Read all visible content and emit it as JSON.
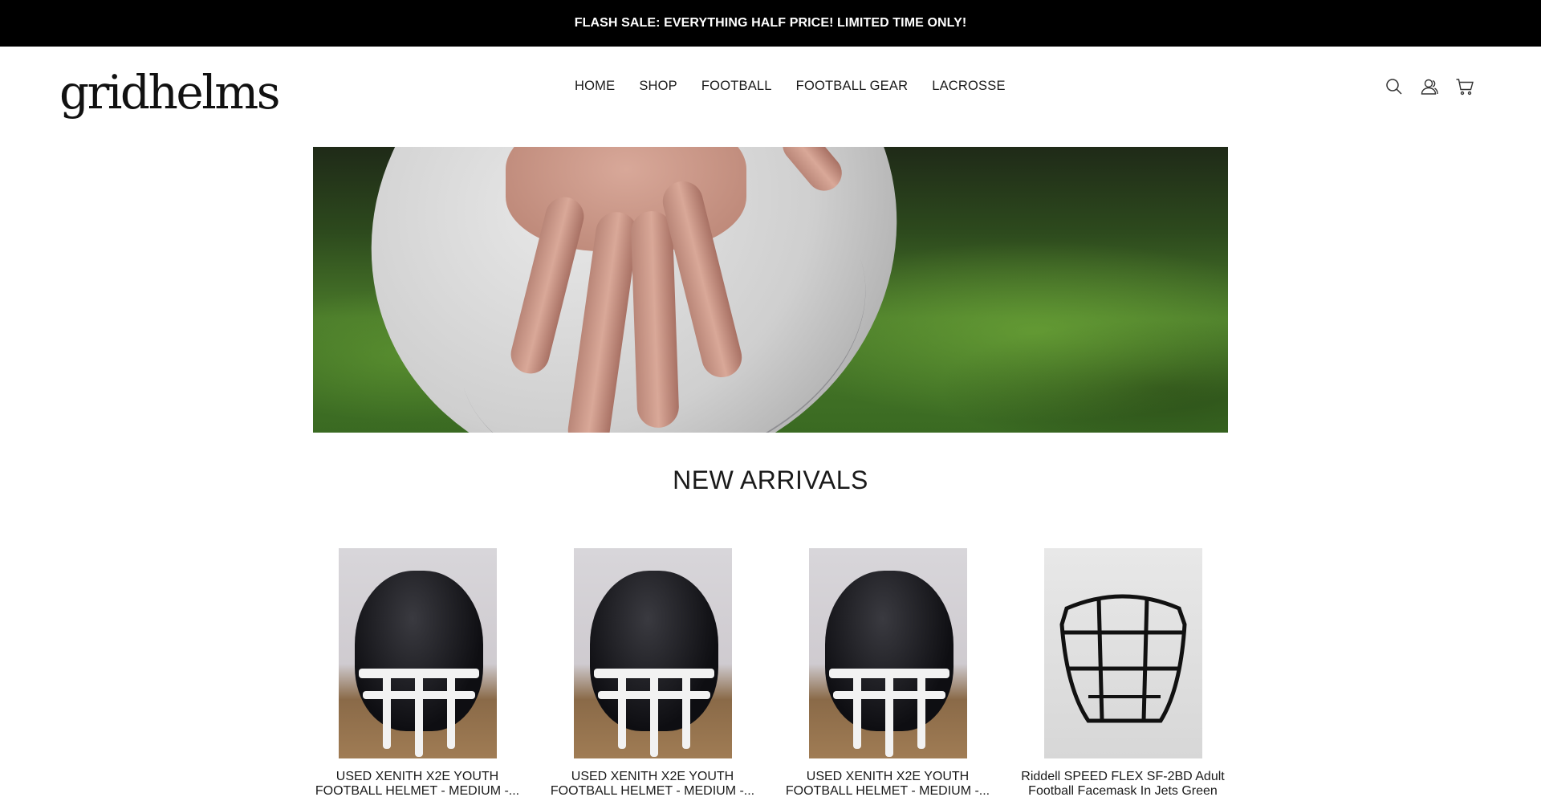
{
  "announcement": {
    "text": "FLASH SALE: EVERYTHING HALF PRICE! LIMITED TIME ONLY!"
  },
  "header": {
    "logo_text": "gridhelms",
    "nav": [
      {
        "label": "HOME"
      },
      {
        "label": "SHOP"
      },
      {
        "label": "FOOTBALL"
      },
      {
        "label": "FOOTBALL GEAR"
      },
      {
        "label": "LACROSSE"
      }
    ],
    "icons": [
      "search-icon",
      "account-icon",
      "cart-icon"
    ]
  },
  "hero": {
    "image": "football-hand-on-grass"
  },
  "new_arrivals": {
    "title": "NEW ARRIVALS",
    "products": [
      {
        "title": "USED XENITH X2E YOUTH FOOTBALL HELMET - MEDIUM -...",
        "image": "black-helmet-white-facemask"
      },
      {
        "title": "USED XENITH X2E YOUTH FOOTBALL HELMET - MEDIUM -...",
        "image": "black-helmet-white-facemask"
      },
      {
        "title": "USED XENITH X2E YOUTH FOOTBALL HELMET - MEDIUM -...",
        "image": "black-helmet-white-facemask"
      },
      {
        "title": "Riddell SPEED FLEX SF-2BD Adult Football Facemask In Jets Green",
        "image": "black-facemask"
      }
    ]
  },
  "colors": {
    "announcement_bg": "#000000",
    "announcement_text": "#ffffff",
    "text": "#1a1a1a",
    "background": "#ffffff"
  }
}
